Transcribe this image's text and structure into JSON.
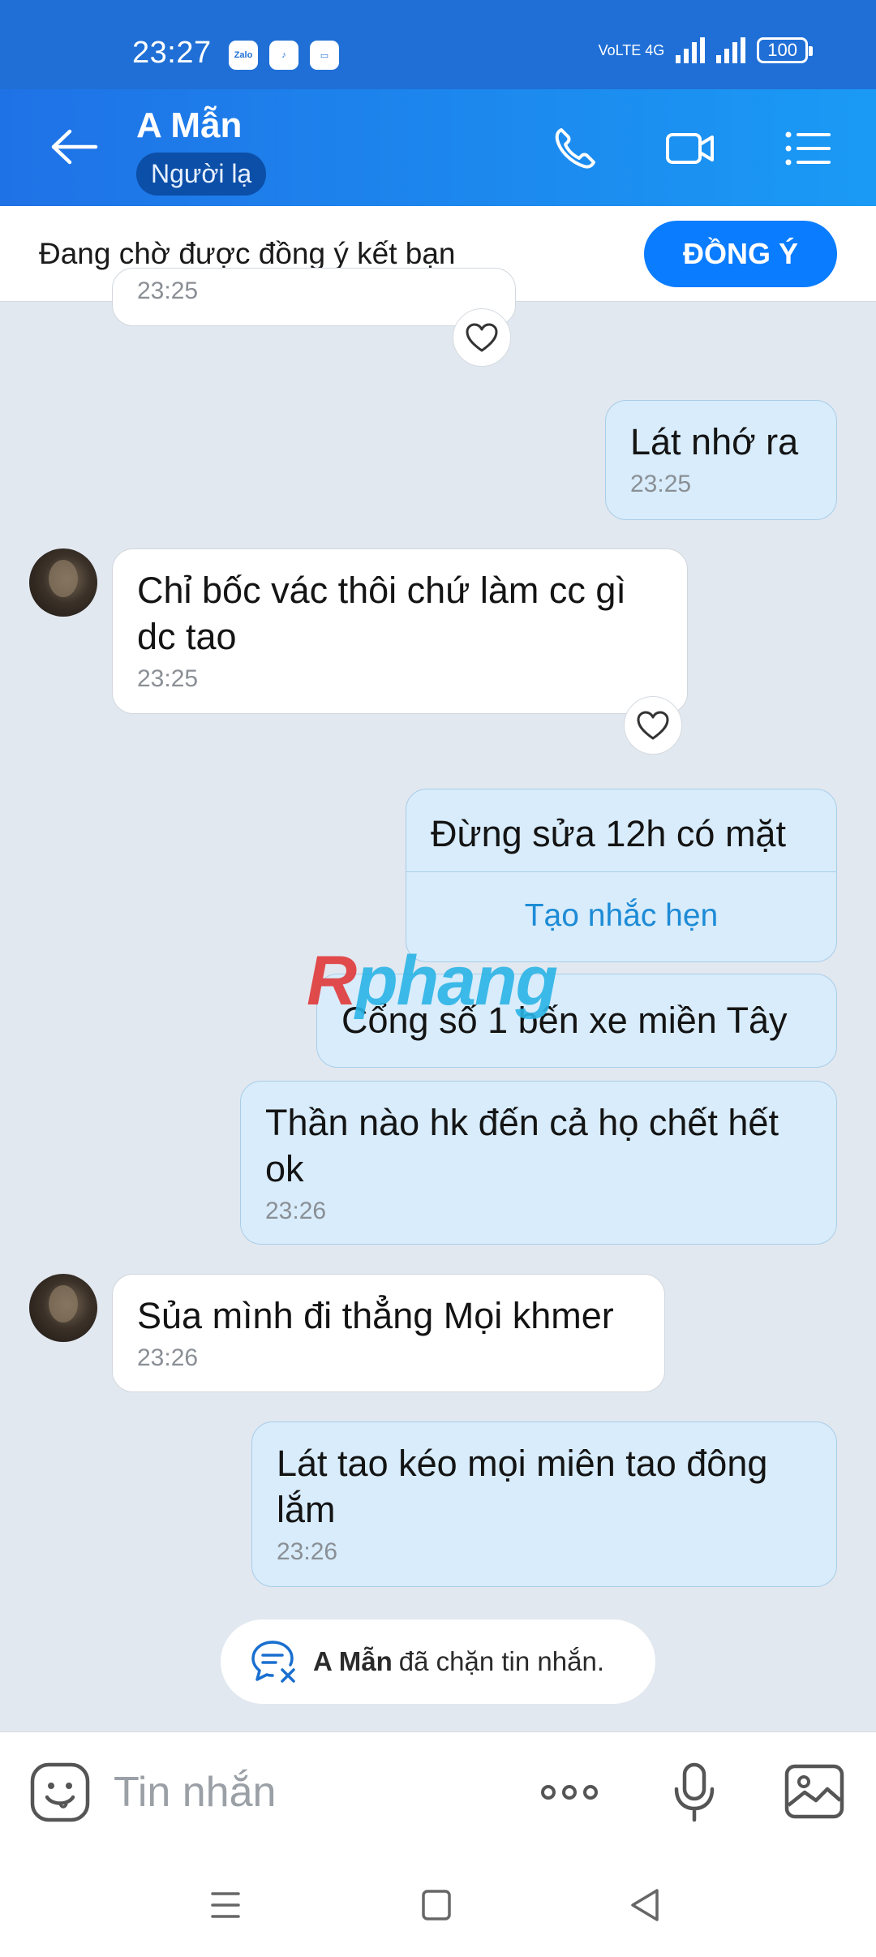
{
  "status_bar": {
    "time": "23:27",
    "app_icons": [
      "Zalo",
      "TikTok",
      "Shopee"
    ],
    "network": "VoLTE 4G",
    "battery": "100"
  },
  "header": {
    "contact_name": "A Mẫn",
    "badge": "Người lạ",
    "icons": [
      "back-arrow-icon",
      "phone-icon",
      "video-call-icon",
      "menu-list-icon"
    ]
  },
  "friend_request": {
    "text": "Đang chờ được đồng ý kết bạn",
    "button": "ĐỒNG Ý"
  },
  "messages": [
    {
      "id": "m0",
      "from": "contact",
      "text": "",
      "time": "23:25",
      "partial": true
    },
    {
      "id": "m1",
      "from": "me",
      "text": "Lát nhớ ra",
      "time": "23:25"
    },
    {
      "id": "m2",
      "from": "contact",
      "text": "Chỉ bốc vác thôi chứ làm cc gì dc tao",
      "time": "23:25"
    },
    {
      "id": "m3",
      "from": "me",
      "text": "Đừng sửa 12h có mặt",
      "action": "Tạo nhắc hẹn"
    },
    {
      "id": "m4",
      "from": "me",
      "text": "Cổng số 1 bến xe miền Tây"
    },
    {
      "id": "m5",
      "from": "me",
      "text": "Thần nào hk đến cả họ chết hết ok",
      "time": "23:26"
    },
    {
      "id": "m6",
      "from": "contact",
      "text": "Sủa mình đi thẳng Mọi khmer",
      "time": "23:26"
    },
    {
      "id": "m7",
      "from": "me",
      "text": "Lát tao kéo mọi miên tao đông lắm",
      "time": "23:26"
    }
  ],
  "watermark": {
    "prefix": "R",
    "rest": "phang"
  },
  "blocked_notice": {
    "name": "A Mẫn",
    "text": "đã chặn tin nhắn."
  },
  "composer": {
    "placeholder": "Tin nhắn",
    "icons": [
      "emoji-icon",
      "more-icon",
      "microphone-icon",
      "image-icon"
    ]
  },
  "colors": {
    "header": "#1f72e6",
    "accent": "#0a7cff",
    "outgoing_bubble": "#d8ecfb",
    "incoming_bubble": "#ffffff",
    "chat_background": "#e2e8f0"
  }
}
